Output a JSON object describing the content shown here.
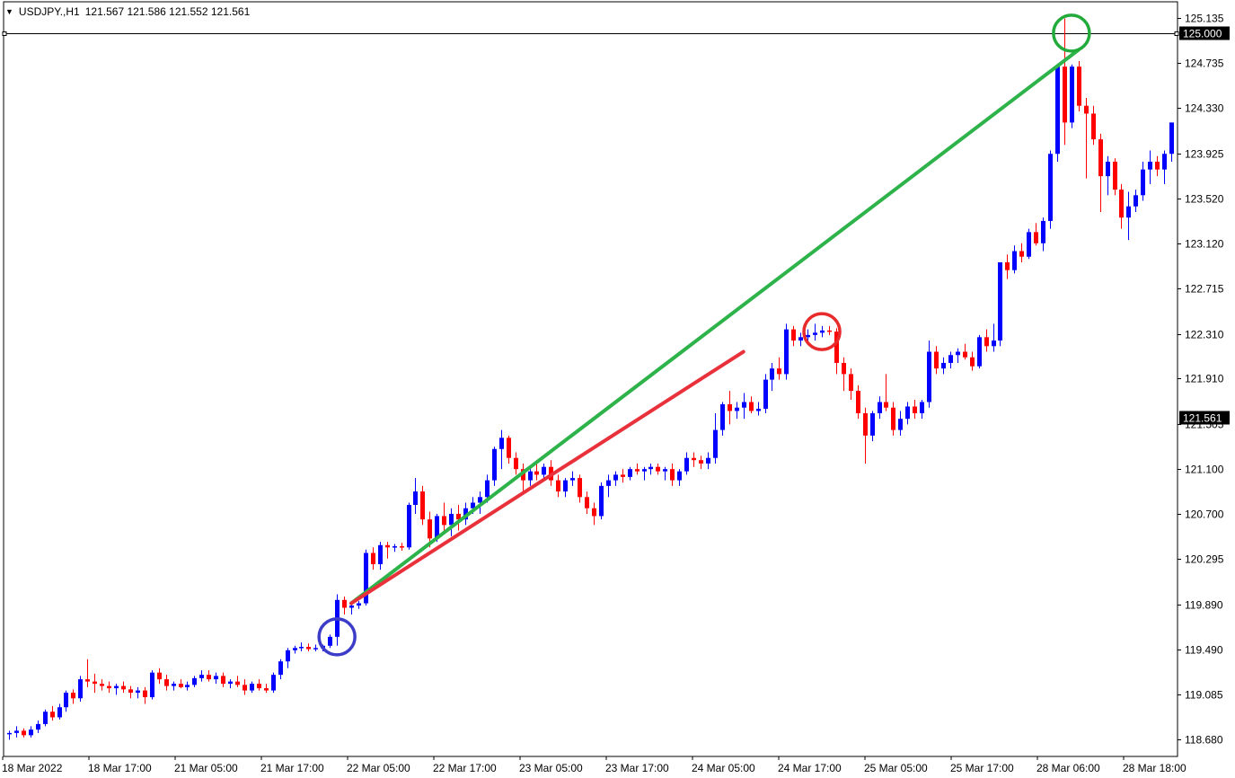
{
  "header": {
    "symbol": "USDJPY.,H1",
    "ohlc": "121.567 121.586 121.552 121.561",
    "menu_icon": "triangle-down-icon"
  },
  "chart_data": {
    "type": "candlestick",
    "bull_color": "#0000ff",
    "bear_color": "#ff0000",
    "ylim": [
      118.53,
      125.28
    ],
    "y_ticks": [
      "125.135",
      "124.735",
      "124.330",
      "123.925",
      "123.520",
      "123.120",
      "122.715",
      "122.310",
      "121.910",
      "121.505",
      "121.100",
      "120.700",
      "120.295",
      "119.890",
      "119.490",
      "119.085",
      "118.680"
    ],
    "x_labels": [
      "18 Mar 2022",
      "18 Mar 17:00",
      "21 Mar 05:00",
      "21 Mar 17:00",
      "22 Mar 05:00",
      "22 Mar 17:00",
      "23 Mar 05:00",
      "23 Mar 17:00",
      "24 Mar 05:00",
      "24 Mar 17:00",
      "25 Mar 05:00",
      "25 Mar 17:00",
      "28 Mar 06:00",
      "28 Mar 18:00"
    ],
    "horizontal_line": {
      "value": 125.0,
      "label": "125.000"
    },
    "current_price": {
      "value": 121.561,
      "label": "121.561"
    },
    "candles": [
      [
        118.73,
        118.76,
        118.68,
        118.74
      ],
      [
        118.74,
        118.8,
        118.7,
        118.76
      ],
      [
        118.76,
        118.78,
        118.7,
        118.72
      ],
      [
        118.72,
        118.8,
        118.7,
        118.77
      ],
      [
        118.77,
        118.85,
        118.74,
        118.82
      ],
      [
        118.82,
        118.95,
        118.8,
        118.93
      ],
      [
        118.93,
        118.98,
        118.85,
        118.88
      ],
      [
        118.88,
        119.0,
        118.86,
        118.97
      ],
      [
        118.97,
        119.12,
        118.93,
        119.1
      ],
      [
        119.1,
        119.13,
        119.0,
        119.05
      ],
      [
        119.05,
        119.25,
        119.02,
        119.22
      ],
      [
        119.22,
        119.4,
        119.15,
        119.2
      ],
      [
        119.2,
        119.27,
        119.1,
        119.18
      ],
      [
        119.18,
        119.22,
        119.12,
        119.16
      ],
      [
        119.16,
        119.2,
        119.1,
        119.14
      ],
      [
        119.14,
        119.18,
        119.08,
        119.16
      ],
      [
        119.16,
        119.2,
        119.1,
        119.13
      ],
      [
        119.13,
        119.16,
        119.05,
        119.1
      ],
      [
        119.1,
        119.15,
        119.05,
        119.12
      ],
      [
        119.12,
        119.15,
        119.0,
        119.06
      ],
      [
        119.06,
        119.3,
        119.04,
        119.28
      ],
      [
        119.28,
        119.32,
        119.18,
        119.22
      ],
      [
        119.22,
        119.26,
        119.12,
        119.16
      ],
      [
        119.16,
        119.2,
        119.12,
        119.18
      ],
      [
        119.18,
        119.22,
        119.14,
        119.15
      ],
      [
        119.15,
        119.2,
        119.12,
        119.17
      ],
      [
        119.17,
        119.25,
        119.15,
        119.23
      ],
      [
        119.23,
        119.3,
        119.2,
        119.26
      ],
      [
        119.26,
        119.3,
        119.2,
        119.22
      ],
      [
        119.22,
        119.28,
        119.18,
        119.25
      ],
      [
        119.25,
        119.28,
        119.15,
        119.18
      ],
      [
        119.18,
        119.22,
        119.14,
        119.2
      ],
      [
        119.2,
        119.25,
        119.15,
        119.17
      ],
      [
        119.17,
        119.22,
        119.08,
        119.12
      ],
      [
        119.12,
        119.2,
        119.1,
        119.18
      ],
      [
        119.18,
        119.22,
        119.12,
        119.14
      ],
      [
        119.14,
        119.18,
        119.1,
        119.12
      ],
      [
        119.12,
        119.28,
        119.1,
        119.26
      ],
      [
        119.26,
        119.4,
        119.22,
        119.38
      ],
      [
        119.38,
        119.5,
        119.32,
        119.48
      ],
      [
        119.48,
        119.52,
        119.45,
        119.5
      ],
      [
        119.5,
        119.55,
        119.47,
        119.51
      ],
      [
        119.51,
        119.54,
        119.47,
        119.49
      ],
      [
        119.49,
        119.53,
        119.47,
        119.5
      ],
      [
        119.5,
        119.53,
        119.47,
        119.52
      ],
      [
        119.52,
        119.62,
        119.5,
        119.6
      ],
      [
        119.6,
        119.98,
        119.52,
        119.93
      ],
      [
        119.93,
        119.96,
        119.8,
        119.86
      ],
      [
        119.86,
        119.9,
        119.8,
        119.88
      ],
      [
        119.88,
        119.92,
        119.85,
        119.9
      ],
      [
        119.9,
        120.38,
        119.88,
        120.35
      ],
      [
        120.35,
        120.4,
        120.2,
        120.25
      ],
      [
        120.25,
        120.45,
        120.2,
        120.42
      ],
      [
        120.42,
        120.45,
        120.3,
        120.4
      ],
      [
        120.4,
        120.43,
        120.36,
        120.41
      ],
      [
        120.41,
        120.44,
        120.37,
        120.4
      ],
      [
        120.4,
        120.8,
        120.38,
        120.78
      ],
      [
        120.78,
        121.02,
        120.7,
        120.9
      ],
      [
        120.9,
        120.95,
        120.6,
        120.65
      ],
      [
        120.65,
        120.72,
        120.4,
        120.48
      ],
      [
        120.48,
        120.7,
        120.45,
        120.68
      ],
      [
        120.68,
        120.8,
        120.55,
        120.6
      ],
      [
        120.6,
        120.75,
        120.5,
        120.7
      ],
      [
        120.7,
        120.78,
        120.55,
        120.65
      ],
      [
        120.65,
        120.8,
        120.6,
        120.75
      ],
      [
        120.75,
        120.85,
        120.7,
        120.8
      ],
      [
        120.8,
        120.9,
        120.7,
        120.85
      ],
      [
        120.85,
        121.05,
        120.8,
        121.0
      ],
      [
        121.0,
        121.3,
        120.95,
        121.28
      ],
      [
        121.28,
        121.45,
        121.1,
        121.38
      ],
      [
        121.38,
        121.4,
        121.15,
        121.2
      ],
      [
        121.2,
        121.25,
        121.05,
        121.1
      ],
      [
        121.1,
        121.15,
        120.9,
        121.0
      ],
      [
        121.0,
        121.12,
        120.95,
        121.08
      ],
      [
        121.08,
        121.18,
        121.0,
        121.05
      ],
      [
        121.05,
        121.15,
        121.0,
        121.12
      ],
      [
        121.12,
        121.18,
        120.95,
        121.0
      ],
      [
        121.0,
        121.05,
        120.85,
        120.9
      ],
      [
        120.9,
        121.02,
        120.85,
        121.0
      ],
      [
        121.0,
        121.08,
        120.95,
        121.02
      ],
      [
        121.02,
        121.05,
        120.8,
        120.85
      ],
      [
        120.85,
        120.9,
        120.7,
        120.75
      ],
      [
        120.75,
        120.8,
        120.6,
        120.68
      ],
      [
        120.68,
        120.98,
        120.65,
        120.95
      ],
      [
        120.95,
        121.05,
        120.85,
        121.0
      ],
      [
        121.0,
        121.08,
        120.95,
        121.05
      ],
      [
        121.05,
        121.1,
        120.98,
        121.03
      ],
      [
        121.03,
        121.12,
        121.0,
        121.1
      ],
      [
        121.1,
        121.15,
        121.05,
        121.08
      ],
      [
        121.08,
        121.12,
        121.0,
        121.1
      ],
      [
        121.1,
        121.15,
        121.05,
        121.12
      ],
      [
        121.12,
        121.15,
        121.05,
        121.08
      ],
      [
        121.08,
        121.12,
        121.0,
        121.1
      ],
      [
        121.1,
        121.15,
        120.95,
        121.0
      ],
      [
        121.0,
        121.1,
        120.95,
        121.08
      ],
      [
        121.08,
        121.25,
        121.05,
        121.2
      ],
      [
        121.2,
        121.25,
        121.12,
        121.18
      ],
      [
        121.18,
        121.22,
        121.1,
        121.15
      ],
      [
        121.15,
        121.25,
        121.1,
        121.2
      ],
      [
        121.2,
        121.6,
        121.15,
        121.45
      ],
      [
        121.45,
        121.7,
        121.4,
        121.68
      ],
      [
        121.68,
        121.8,
        121.5,
        121.62
      ],
      [
        121.62,
        121.7,
        121.55,
        121.65
      ],
      [
        121.65,
        121.78,
        121.55,
        121.7
      ],
      [
        121.7,
        121.75,
        121.6,
        121.62
      ],
      [
        121.62,
        121.7,
        121.58,
        121.64
      ],
      [
        121.64,
        121.95,
        121.6,
        121.9
      ],
      [
        121.9,
        122.05,
        121.8,
        122.0
      ],
      [
        122.0,
        122.1,
        121.9,
        121.95
      ],
      [
        121.95,
        122.4,
        121.9,
        122.35
      ],
      [
        122.35,
        122.38,
        122.2,
        122.25
      ],
      [
        122.25,
        122.32,
        122.2,
        122.28
      ],
      [
        122.28,
        122.35,
        122.22,
        122.3
      ],
      [
        122.3,
        122.4,
        122.25,
        122.32
      ],
      [
        122.32,
        122.38,
        122.28,
        122.34
      ],
      [
        122.34,
        122.38,
        122.3,
        122.33
      ],
      [
        122.33,
        122.36,
        121.95,
        122.05
      ],
      [
        122.05,
        122.1,
        121.8,
        121.95
      ],
      [
        121.95,
        122.0,
        121.72,
        121.8
      ],
      [
        121.8,
        121.85,
        121.55,
        121.6
      ],
      [
        121.6,
        121.65,
        121.15,
        121.4
      ],
      [
        121.4,
        121.62,
        121.35,
        121.6
      ],
      [
        121.6,
        121.75,
        121.55,
        121.7
      ],
      [
        121.7,
        121.95,
        121.62,
        121.65
      ],
      [
        121.65,
        121.7,
        121.4,
        121.45
      ],
      [
        121.45,
        121.62,
        121.4,
        121.55
      ],
      [
        121.55,
        121.7,
        121.5,
        121.66
      ],
      [
        121.66,
        121.72,
        121.55,
        121.6
      ],
      [
        121.6,
        121.72,
        121.55,
        121.7
      ],
      [
        121.7,
        122.25,
        121.65,
        122.15
      ],
      [
        122.15,
        122.2,
        121.95,
        122.0
      ],
      [
        122.0,
        122.1,
        121.95,
        122.05
      ],
      [
        122.05,
        122.15,
        122.0,
        122.12
      ],
      [
        122.12,
        122.18,
        122.05,
        122.15
      ],
      [
        122.15,
        122.22,
        122.08,
        122.1
      ],
      [
        122.1,
        122.15,
        121.98,
        122.02
      ],
      [
        122.02,
        122.3,
        122.0,
        122.28
      ],
      [
        122.28,
        122.35,
        122.15,
        122.2
      ],
      [
        122.2,
        122.4,
        122.15,
        122.25
      ],
      [
        122.25,
        122.95,
        122.2,
        122.95
      ],
      [
        122.95,
        123.02,
        122.8,
        122.88
      ],
      [
        122.88,
        123.1,
        122.85,
        123.05
      ],
      [
        123.05,
        123.12,
        122.95,
        123.0
      ],
      [
        123.0,
        123.25,
        122.98,
        123.22
      ],
      [
        123.22,
        123.3,
        123.1,
        123.12
      ],
      [
        123.12,
        123.35,
        123.05,
        123.32
      ],
      [
        123.32,
        123.95,
        123.25,
        123.92
      ],
      [
        123.92,
        124.7,
        123.85,
        124.7
      ],
      [
        124.7,
        125.13,
        124.0,
        124.2
      ],
      [
        124.2,
        124.72,
        124.15,
        124.7
      ],
      [
        124.7,
        124.75,
        124.3,
        124.35
      ],
      [
        124.35,
        124.42,
        123.7,
        124.28
      ],
      [
        124.28,
        124.35,
        124.0,
        124.05
      ],
      [
        124.05,
        124.1,
        123.4,
        123.72
      ],
      [
        123.72,
        123.9,
        123.55,
        123.85
      ],
      [
        123.85,
        123.88,
        123.55,
        123.6
      ],
      [
        123.6,
        123.65,
        123.25,
        123.35
      ],
      [
        123.35,
        123.58,
        123.15,
        123.45
      ],
      [
        123.45,
        123.6,
        123.4,
        123.55
      ],
      [
        123.55,
        123.85,
        123.5,
        123.78
      ],
      [
        123.78,
        123.95,
        123.65,
        123.85
      ],
      [
        123.85,
        123.9,
        123.72,
        123.78
      ],
      [
        123.78,
        123.95,
        123.65,
        123.92
      ],
      [
        123.92,
        124.2,
        123.85,
        124.2
      ]
    ],
    "trendlines": [
      {
        "color": "#2db34a",
        "from": [
          48,
          119.9
        ],
        "to": [
          150,
          124.85
        ]
      },
      {
        "color": "#e8313a",
        "from": [
          48,
          119.9
        ],
        "to": [
          103,
          122.15
        ]
      }
    ],
    "markers": [
      {
        "color": "#3c3cc8",
        "index": 46,
        "value": 119.6
      },
      {
        "color": "#e82a2a",
        "index": 114,
        "value": 122.33
      },
      {
        "color": "#22aa3a",
        "index": 149,
        "value": 125.0
      }
    ]
  }
}
